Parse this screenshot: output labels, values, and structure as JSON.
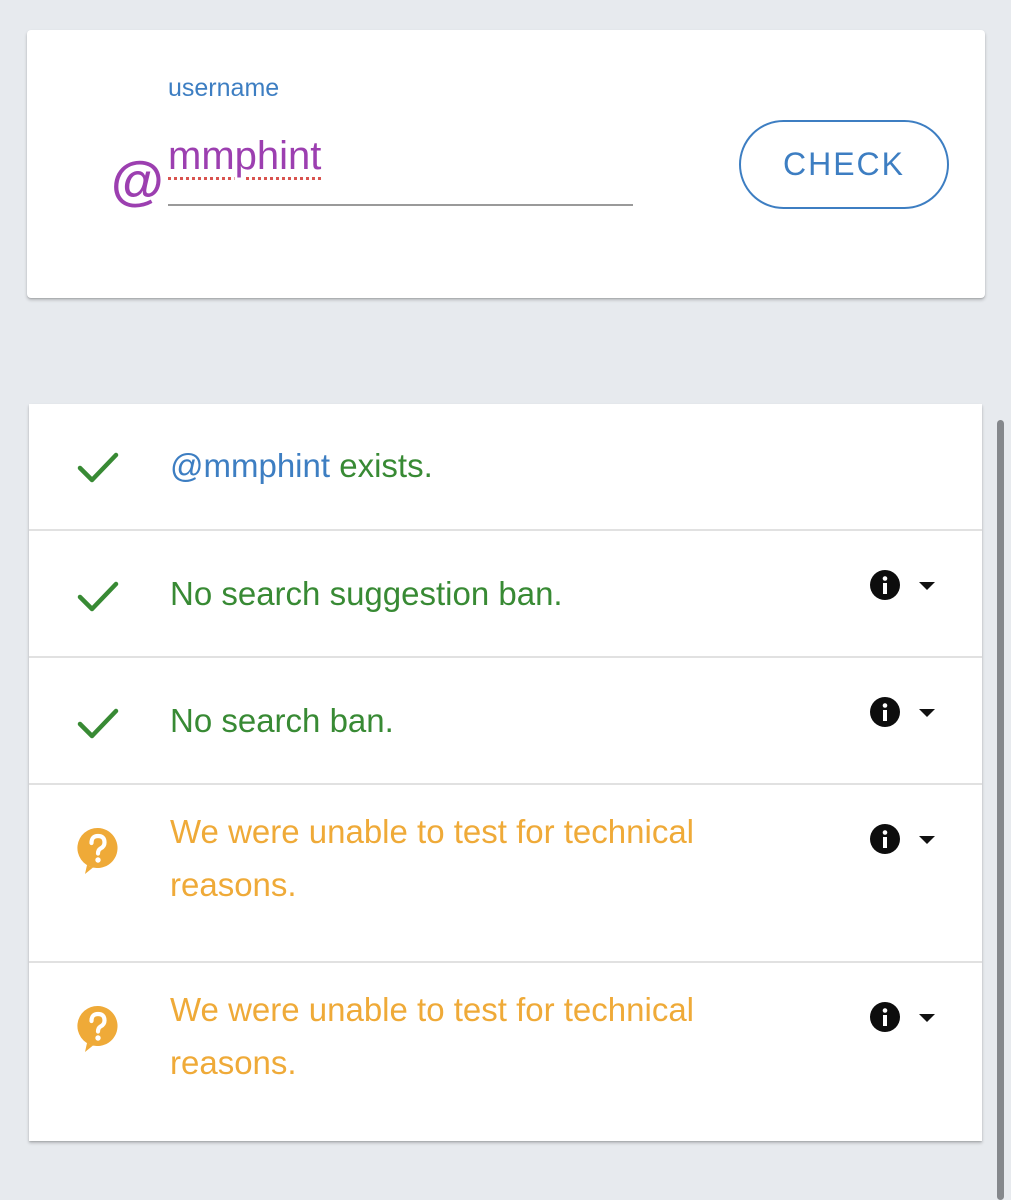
{
  "search": {
    "label": "username",
    "value": "mmphint",
    "prefix_icon": "at-icon",
    "button_label": "CHECK"
  },
  "results": [
    {
      "status": "ok",
      "icon": "checkmark-icon",
      "handle": "@mmphint",
      "text": " exists.",
      "has_info": false
    },
    {
      "status": "ok",
      "icon": "checkmark-icon",
      "text": "No search suggestion ban.",
      "has_info": true
    },
    {
      "status": "ok",
      "icon": "checkmark-icon",
      "text": "No search ban.",
      "has_info": true
    },
    {
      "status": "unknown",
      "icon": "question-bubble-icon",
      "text": "We were unable to test for technical reasons.",
      "has_info": true
    },
    {
      "status": "unknown",
      "icon": "question-bubble-icon",
      "text": "We were unable to test for technical reasons.",
      "has_info": true
    }
  ],
  "colors": {
    "background": "#e7eaee",
    "accent_blue": "#3d7ec2",
    "input_purple": "#9c3fb0",
    "success_green": "#388a34",
    "warning_orange": "#efaa38"
  }
}
